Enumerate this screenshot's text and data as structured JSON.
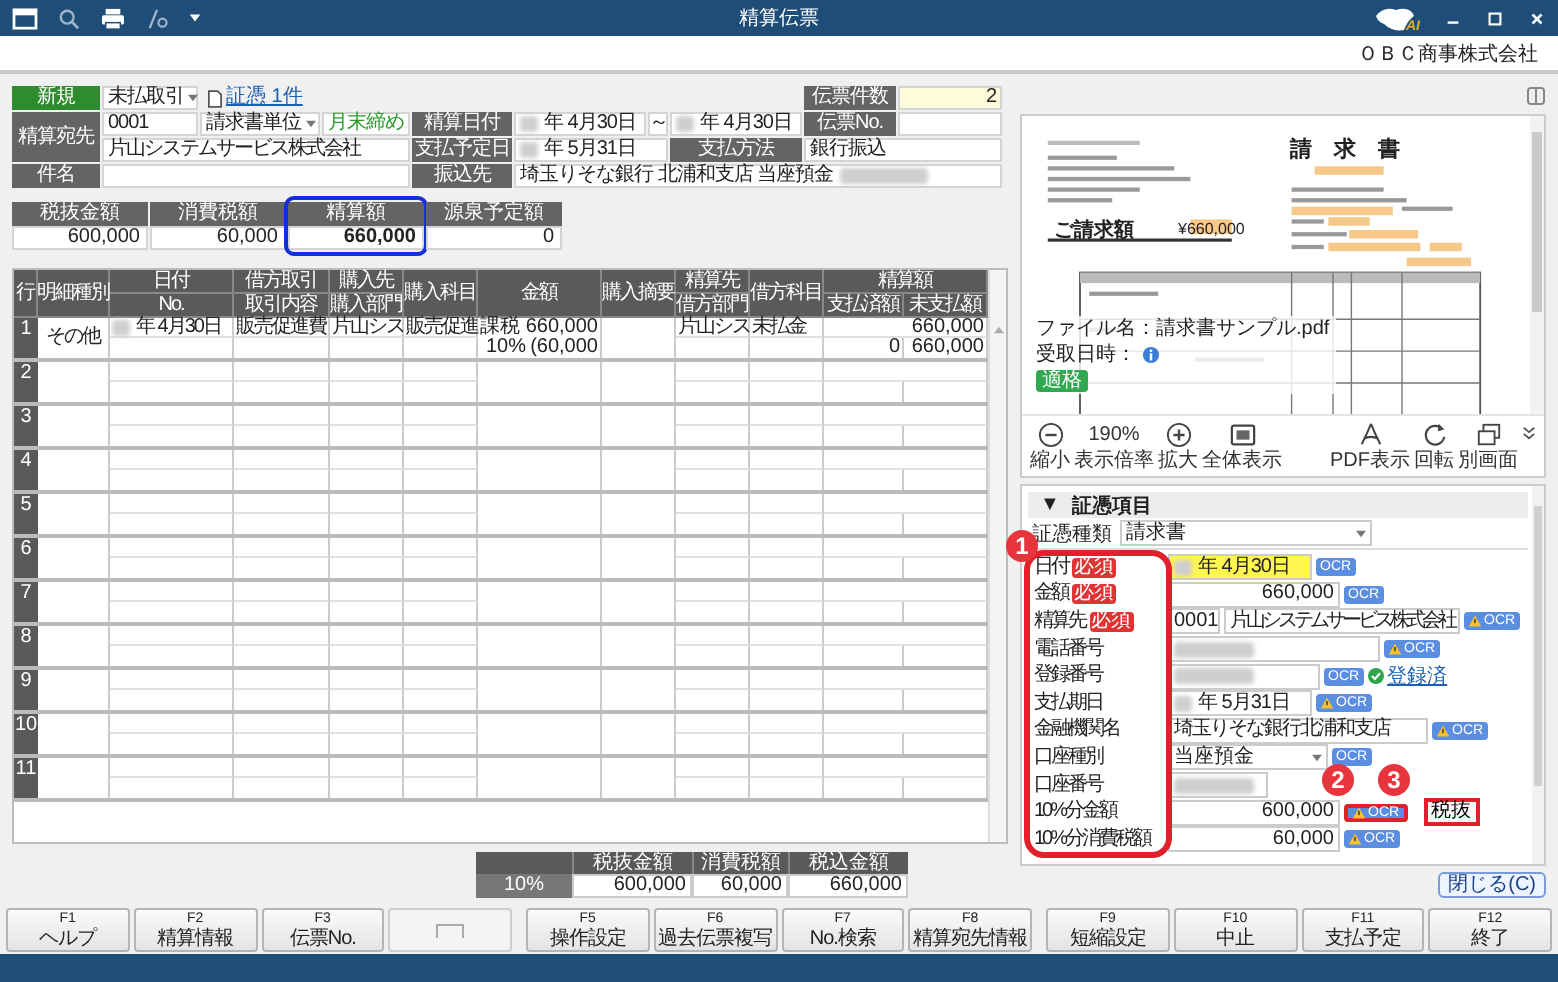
{
  "window": {
    "title": "精算伝票",
    "ai_badge": "AI",
    "company": "ＯＢＣ商事株式会社"
  },
  "header": {
    "mode": "新規",
    "transaction": "未払取引",
    "attachment_link": "証憑 1件",
    "slip_count_label": "伝票件数",
    "slip_count": "2",
    "payee_label": "精算宛先",
    "payee_code": "0001",
    "unit": "請求書単位",
    "closing": "月末締め",
    "payee_name": "片山システムサービス株式会社",
    "settle_date_label": "精算日付",
    "settle_date_from": "年 4月30日",
    "tilde": "～",
    "settle_date_to": "年 4月30日",
    "slip_no_label": "伝票No.",
    "due_label": "支払予定日",
    "due_date": "年 5月31日",
    "method_label": "支払方法",
    "method": "銀行振込",
    "subject_label": "件名",
    "bank_label": "振込先",
    "bank": "埼玉りそな銀行 北浦和支店 当座預金"
  },
  "totals": [
    {
      "label": "税抜金額",
      "value": "600,000",
      "highlighted": false
    },
    {
      "label": "消費税額",
      "value": "60,000",
      "highlighted": false
    },
    {
      "label": "精算額",
      "value": "660,000",
      "highlighted": true
    },
    {
      "label": "源泉予定額",
      "value": "0",
      "highlighted": false
    }
  ],
  "table": {
    "columns": [
      {
        "label": "行"
      },
      {
        "label": "明細種別"
      },
      {
        "label": "日付",
        "sub": "No."
      },
      {
        "label": "借方取引",
        "sub": "取引内容"
      },
      {
        "label": "購入先",
        "sub": "購入部門"
      },
      {
        "label": "購入科目"
      },
      {
        "label": "金額"
      },
      {
        "label": "購入摘要"
      },
      {
        "label": "精算先",
        "sub": "借方部門"
      },
      {
        "label": "借方科目"
      },
      {
        "label": "精算額",
        "subs": [
          "支払済額",
          "未支払額"
        ]
      }
    ],
    "rows": [
      {
        "no": "1",
        "type": "その他",
        "masked": true,
        "date": "年 4月30日",
        "trade": "販売促進費",
        "vendor": "片山シス",
        "account": "販売促進",
        "tax": "課税",
        "amount": "660,000",
        "rate": "10%",
        "tax_amount": "(60,000",
        "payee": "片山シス",
        "debit_account": "未払金",
        "total": "660,000",
        "paid": "0",
        "unpaid": "660,000"
      },
      {
        "no": "2"
      },
      {
        "no": "3"
      },
      {
        "no": "4"
      },
      {
        "no": "5"
      },
      {
        "no": "6"
      },
      {
        "no": "7"
      },
      {
        "no": "8"
      },
      {
        "no": "9"
      },
      {
        "no": "10"
      },
      {
        "no": "11"
      }
    ]
  },
  "bottom_totals": {
    "columns": [
      "税抜金額",
      "消費税額",
      "税込金額"
    ],
    "rows": [
      {
        "rate": "10%",
        "values": [
          "600,000",
          "60,000",
          "660,000"
        ]
      }
    ]
  },
  "preview": {
    "doc_title": "請　求　書",
    "amount_label": "ご請求額",
    "amount": "¥660,000",
    "file_name": "ファイル名：請求書サンプル.pdf",
    "received": "受取日時：",
    "badge": "適格",
    "tools": [
      {
        "kind": "zoom-out",
        "label": "縮小"
      },
      {
        "kind": "zoom-level",
        "value": "190%",
        "label": "表示倍率"
      },
      {
        "kind": "zoom-in",
        "label": "拡大"
      },
      {
        "kind": "fit",
        "label": "全体表示"
      },
      {
        "kind": "pdf",
        "label": "PDF表示"
      },
      {
        "kind": "rotate",
        "label": "回転"
      },
      {
        "kind": "window",
        "label": "別画面"
      }
    ]
  },
  "form": {
    "toggle": "▼",
    "section": "証憑項目",
    "doc_type_label": "証憑種類",
    "doc_type": "請求書",
    "labels_framed": true,
    "fields": [
      {
        "label": "日付",
        "badge": "必須",
        "kind": "date",
        "masked": true,
        "value": "年  4月30日",
        "highlighted": true,
        "ocr_button": "OCR",
        "ocr_warning": false,
        "ocr_boxed": false
      },
      {
        "label": "金額",
        "badge": "必須",
        "kind": "amount",
        "value": "660,000",
        "ocr_button": "OCR",
        "ocr_warning": false,
        "ocr_boxed": false
      },
      {
        "label": "精算先",
        "badge": "必須",
        "kind": "payee",
        "code": "0001",
        "value": "片山システムサービス株式会社",
        "ocr_button": "OCR",
        "ocr_warning": true,
        "ocr_boxed": false
      },
      {
        "label": "電話番号",
        "kind": "phone",
        "masked": true,
        "ocr_button": "OCR",
        "ocr_warning": true,
        "ocr_boxed": false
      },
      {
        "label": "登録番号",
        "kind": "registration",
        "masked": true,
        "status": "登録済",
        "ocr_button": "OCR",
        "ocr_warning": false,
        "ocr_boxed": false
      },
      {
        "label": "支払期日",
        "kind": "date",
        "masked": true,
        "value": "年  5月31日",
        "highlighted": false,
        "ocr_button": "OCR",
        "ocr_warning": true,
        "ocr_boxed": false
      },
      {
        "label": "金融機関名",
        "kind": "text",
        "value": "埼玉りそな銀行北浦和支店",
        "ocr_button": "OCR",
        "ocr_warning": true,
        "ocr_boxed": false
      },
      {
        "label": "口座種別",
        "kind": "select",
        "value": "当座預金",
        "ocr_button": "OCR",
        "ocr_warning": false,
        "ocr_boxed": false
      },
      {
        "label": "口座番号",
        "kind": "account",
        "masked": true
      },
      {
        "label": "10%分金額",
        "kind": "amount",
        "value": "600,000",
        "ocr_button": "OCR",
        "ocr_warning": true,
        "ocr_boxed": true,
        "extra_button": "税抜",
        "extra_boxed": true
      },
      {
        "label": "10%分消費税額",
        "kind": "amount",
        "value": "60,000",
        "ocr_button": "OCR",
        "ocr_warning": true,
        "ocr_boxed": false
      }
    ]
  },
  "callouts": [
    {
      "label": "1"
    },
    {
      "label": "2"
    },
    {
      "label": "3"
    }
  ],
  "close_button": "閉じる(C)",
  "function_keys": [
    {
      "key": "F1",
      "label": "ヘルプ",
      "disabled": false
    },
    {
      "key": "F2",
      "label": "精算情報",
      "disabled": false
    },
    {
      "key": "F3",
      "label": "伝票No.",
      "disabled": false
    },
    {
      "disabled": true
    },
    {
      "key": "F5",
      "label": "操作設定",
      "disabled": false
    },
    {
      "key": "F6",
      "label": "過去伝票複写",
      "disabled": false
    },
    {
      "key": "F7",
      "label": "No.検索",
      "disabled": false
    },
    {
      "key": "F8",
      "label": "精算宛先情報",
      "disabled": false
    },
    {
      "key": "F9",
      "label": "短縮設定",
      "disabled": false
    },
    {
      "key": "F10",
      "label": "中止",
      "disabled": false
    },
    {
      "key": "F11",
      "label": "支払予定",
      "disabled": false
    },
    {
      "key": "F12",
      "label": "終了",
      "disabled": false
    }
  ]
}
